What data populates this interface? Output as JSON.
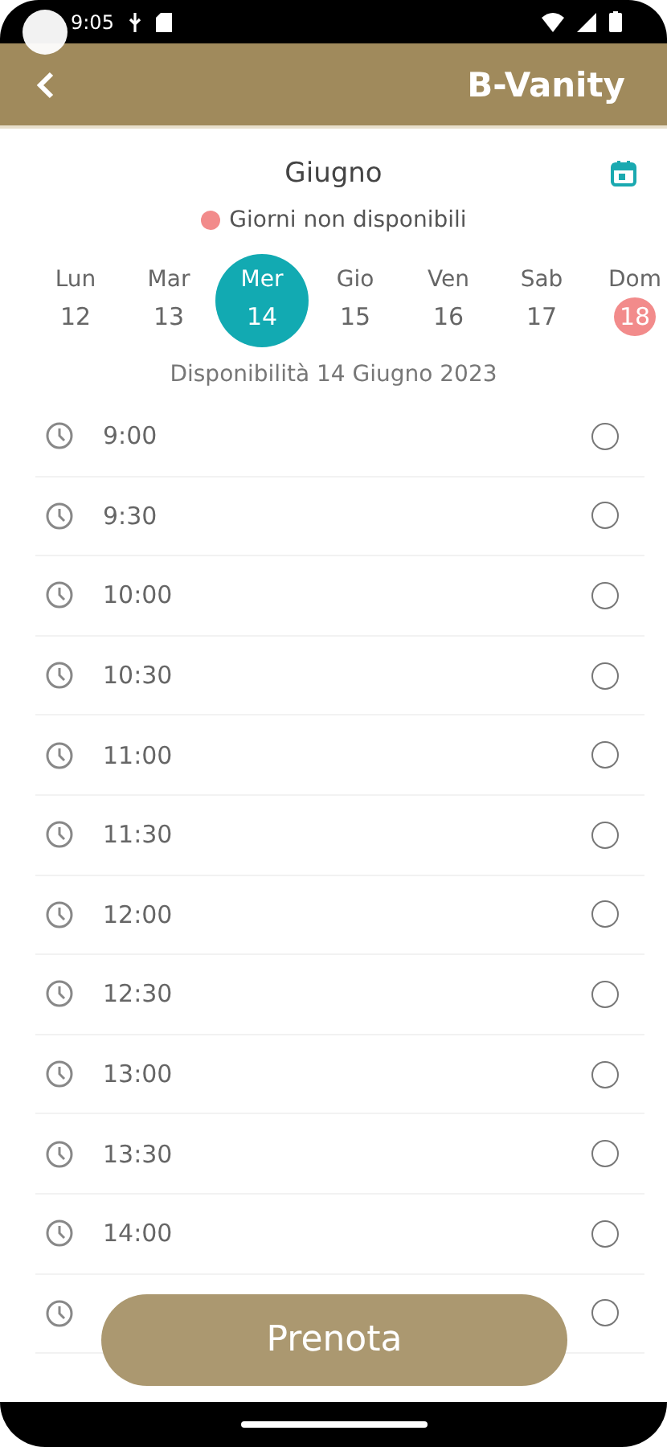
{
  "status_bar": {
    "time": "9:05"
  },
  "header": {
    "title": "B-Vanity"
  },
  "calendar": {
    "month": "Giugno",
    "legend": {
      "label": "Giorni non disponibili",
      "color": "#f28b8b"
    },
    "days": [
      {
        "weekday": "Lun",
        "day": "12",
        "selected": false,
        "unavailable": false
      },
      {
        "weekday": "Mar",
        "day": "13",
        "selected": false,
        "unavailable": false
      },
      {
        "weekday": "Mer",
        "day": "14",
        "selected": true,
        "unavailable": false
      },
      {
        "weekday": "Gio",
        "day": "15",
        "selected": false,
        "unavailable": false
      },
      {
        "weekday": "Ven",
        "day": "16",
        "selected": false,
        "unavailable": false
      },
      {
        "weekday": "Sab",
        "day": "17",
        "selected": false,
        "unavailable": false
      },
      {
        "weekday": "Dom",
        "day": "18",
        "selected": false,
        "unavailable": true
      }
    ]
  },
  "availability_title": "Disponibilità 14 Giugno 2023",
  "slots": [
    {
      "time": "9:00",
      "selected": false
    },
    {
      "time": "9:30",
      "selected": false
    },
    {
      "time": "10:00",
      "selected": false
    },
    {
      "time": "10:30",
      "selected": false
    },
    {
      "time": "11:00",
      "selected": false
    },
    {
      "time": "11:30",
      "selected": false
    },
    {
      "time": "12:00",
      "selected": false
    },
    {
      "time": "12:30",
      "selected": false
    },
    {
      "time": "13:00",
      "selected": false
    },
    {
      "time": "13:30",
      "selected": false
    },
    {
      "time": "14:00",
      "selected": false
    },
    {
      "selected": false
    }
  ],
  "book_button": "Prenota"
}
